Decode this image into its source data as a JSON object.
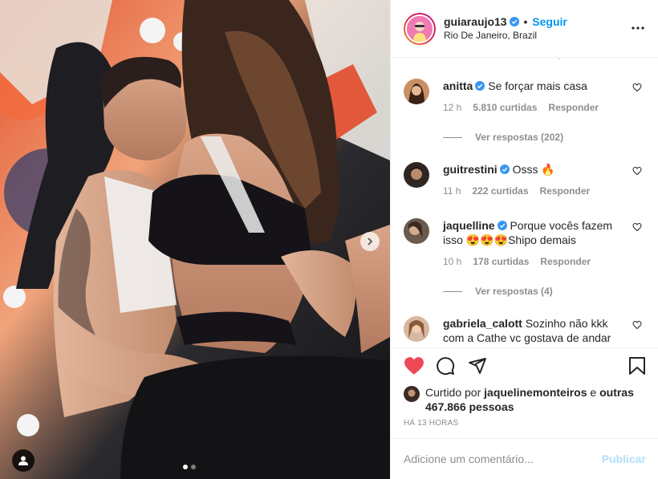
{
  "post": {
    "photo_alt_icon": "photo-icon",
    "carousel": {
      "total": 2,
      "current": 1
    }
  },
  "header": {
    "username": "guiaraujo13",
    "separator": "•",
    "follow_label": "Seguir",
    "location": "Rio De Janeiro, Brazil",
    "more_icon": "more-horizontal-icon"
  },
  "comments": [
    {
      "user": "anitta",
      "verified": true,
      "text": "Se forçar mais casa",
      "time": "12 h",
      "likes": "5.810 curtidas",
      "reply": "Responder",
      "view_replies": "Ver respostas (202)"
    },
    {
      "user": "guitrestini",
      "verified": true,
      "text": "Osss 🔥",
      "time": "11 h",
      "likes": "222 curtidas",
      "reply": "Responder",
      "view_replies": ""
    },
    {
      "user": "jaquelline",
      "verified": true,
      "text": "Porque vocês fazem isso 😍😍😍Shipo demais",
      "time": "10 h",
      "likes": "178 curtidas",
      "reply": "Responder",
      "view_replies": "Ver respostas (4)"
    },
    {
      "user": "gabriela_calott",
      "verified": false,
      "text": "Sozinho não kkk com a Cathe vc gostava de andar",
      "time": "",
      "likes": "",
      "reply": "",
      "view_replies": ""
    }
  ],
  "actions": {
    "like_icon": "heart-filled-icon",
    "comment_icon": "comment-icon",
    "share_icon": "share-icon",
    "save_icon": "bookmark-icon",
    "like_color": "#ed4956"
  },
  "likes": {
    "prefix": "Curtido por",
    "user": "jaquelinemonteiros",
    "and": "e",
    "others": "outras 467.866 pessoas"
  },
  "time_ago": "Há 13 horas",
  "add_comment": {
    "placeholder": "Adicione um comentário...",
    "publish_label": "Publicar"
  },
  "colors": {
    "accent": "#0095f6",
    "verified": "#3897f0",
    "publish_disabled": "#b2dffc"
  }
}
